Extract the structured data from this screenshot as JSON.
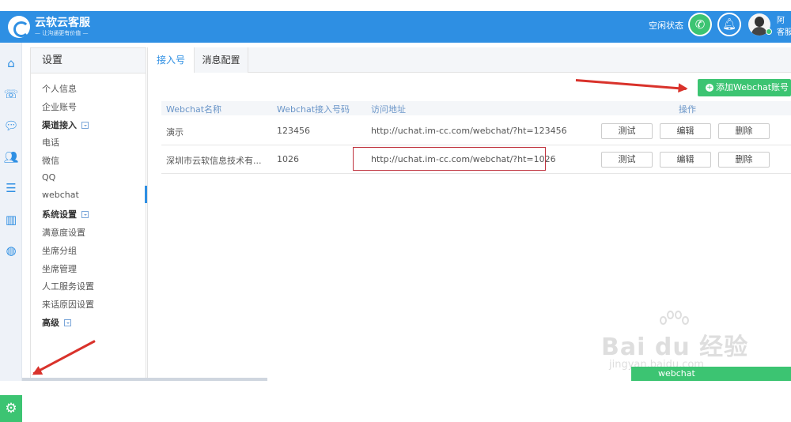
{
  "header": {
    "app_title": "云软云客服",
    "app_subtitle": "— 让沟通更有价值 —",
    "status_label": "空闲状态",
    "user_name": "阿",
    "user_role": "客服"
  },
  "leftnav": {
    "icons": [
      "home-icon",
      "phone-icon",
      "chat-icon",
      "users-icon",
      "list-icon",
      "bar-chart-icon",
      "compass-icon",
      "gear-icon"
    ]
  },
  "settings": {
    "title": "设置",
    "items": [
      {
        "label": "个人信息",
        "group": false
      },
      {
        "label": "企业账号",
        "group": false
      },
      {
        "label": "渠道接入",
        "group": true
      },
      {
        "label": "电话",
        "group": false
      },
      {
        "label": "微信",
        "group": false
      },
      {
        "label": "QQ",
        "group": false
      },
      {
        "label": "webchat",
        "group": false,
        "active": true
      },
      {
        "label": "系统设置",
        "group": true
      },
      {
        "label": "满意度设置",
        "group": false
      },
      {
        "label": "坐席分组",
        "group": false
      },
      {
        "label": "坐席管理",
        "group": false
      },
      {
        "label": "人工服务设置",
        "group": false
      },
      {
        "label": "来话原因设置",
        "group": false
      },
      {
        "label": "高级",
        "group": true
      }
    ]
  },
  "tabs": [
    {
      "label": "接入号",
      "active": true
    },
    {
      "label": "消息配置",
      "active": false
    }
  ],
  "toolbar": {
    "add_button_label": "添加Webchat账号"
  },
  "table": {
    "columns": [
      "Webchat名称",
      "Webchat接入号码",
      "访问地址",
      "操作"
    ],
    "rows": [
      {
        "name": "演示",
        "number": "123456",
        "url": "http://uchat.im-cc.com/webchat/?ht=123456"
      },
      {
        "name": "深圳市云软信息技术有...",
        "number": "1026",
        "url": "http://uchat.im-cc.com/webchat/?ht=1026"
      }
    ],
    "actions": {
      "test": "测试",
      "edit": "编辑",
      "delete": "删除"
    }
  },
  "footer": {
    "webchat_label": "webchat"
  },
  "watermark": {
    "brand": "Bai du 经验",
    "site": "jingyan.baidu.com"
  },
  "colors": {
    "primary": "#2e8fe3",
    "success": "#3cc472",
    "highlight": "#c0343f",
    "annotation_arrow": "#d9322b"
  }
}
